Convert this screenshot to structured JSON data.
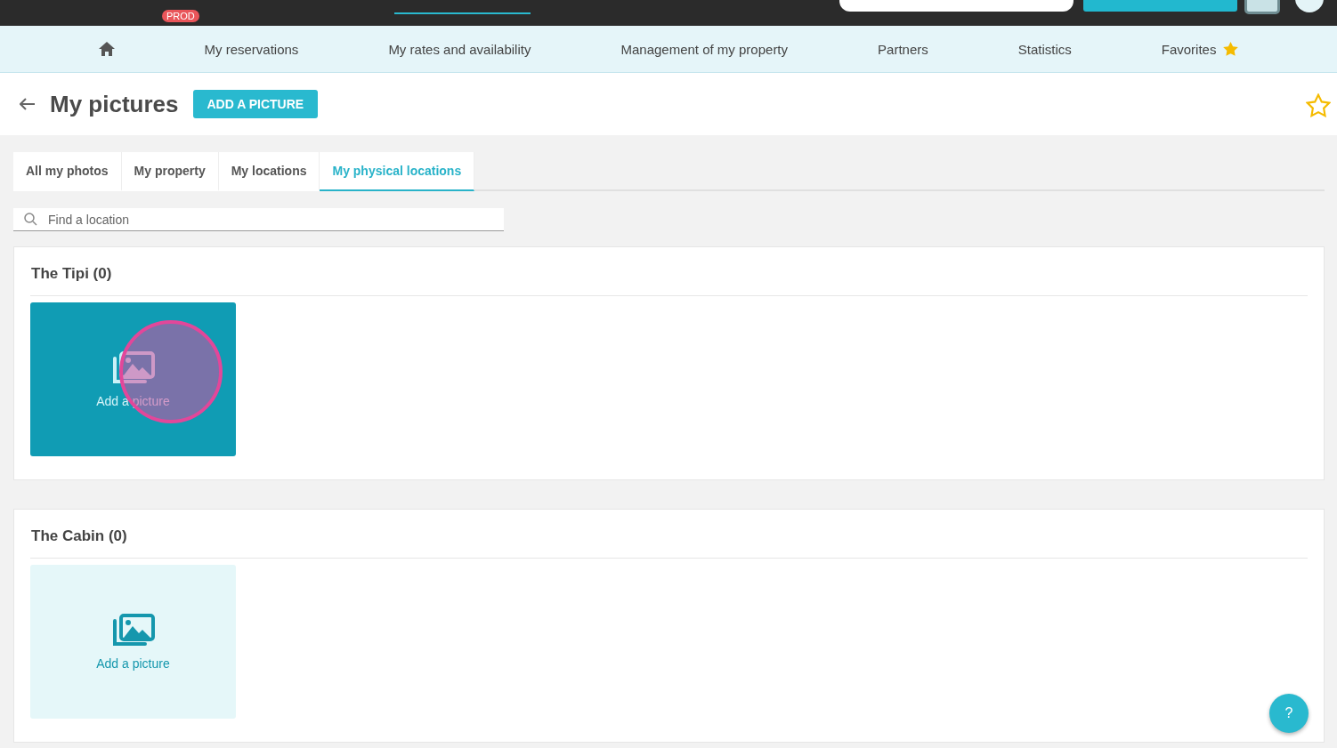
{
  "topbar": {
    "badge": "PROD"
  },
  "nav": {
    "items": [
      {
        "label": "My reservations"
      },
      {
        "label": "My rates and availability"
      },
      {
        "label": "Management of my property"
      },
      {
        "label": "Partners"
      },
      {
        "label": "Statistics"
      },
      {
        "label": "Favorites",
        "starred": true
      }
    ]
  },
  "header": {
    "title": "My pictures",
    "button": "ADD A PICTURE"
  },
  "tabs": [
    {
      "label": "All my photos",
      "selected": false
    },
    {
      "label": "My property",
      "selected": false
    },
    {
      "label": "My locations",
      "selected": false
    },
    {
      "label": "My physical locations",
      "selected": true
    }
  ],
  "search": {
    "placeholder": "Find a location"
  },
  "sections": [
    {
      "title": "The Tipi (0)",
      "tile": {
        "label": "Add a picture",
        "hovered": true,
        "clicked": true
      }
    },
    {
      "title": "The Cabin (0)",
      "tile": {
        "label": "Add a picture",
        "hovered": false,
        "clicked": false
      }
    }
  ],
  "help": {
    "label": "?"
  }
}
